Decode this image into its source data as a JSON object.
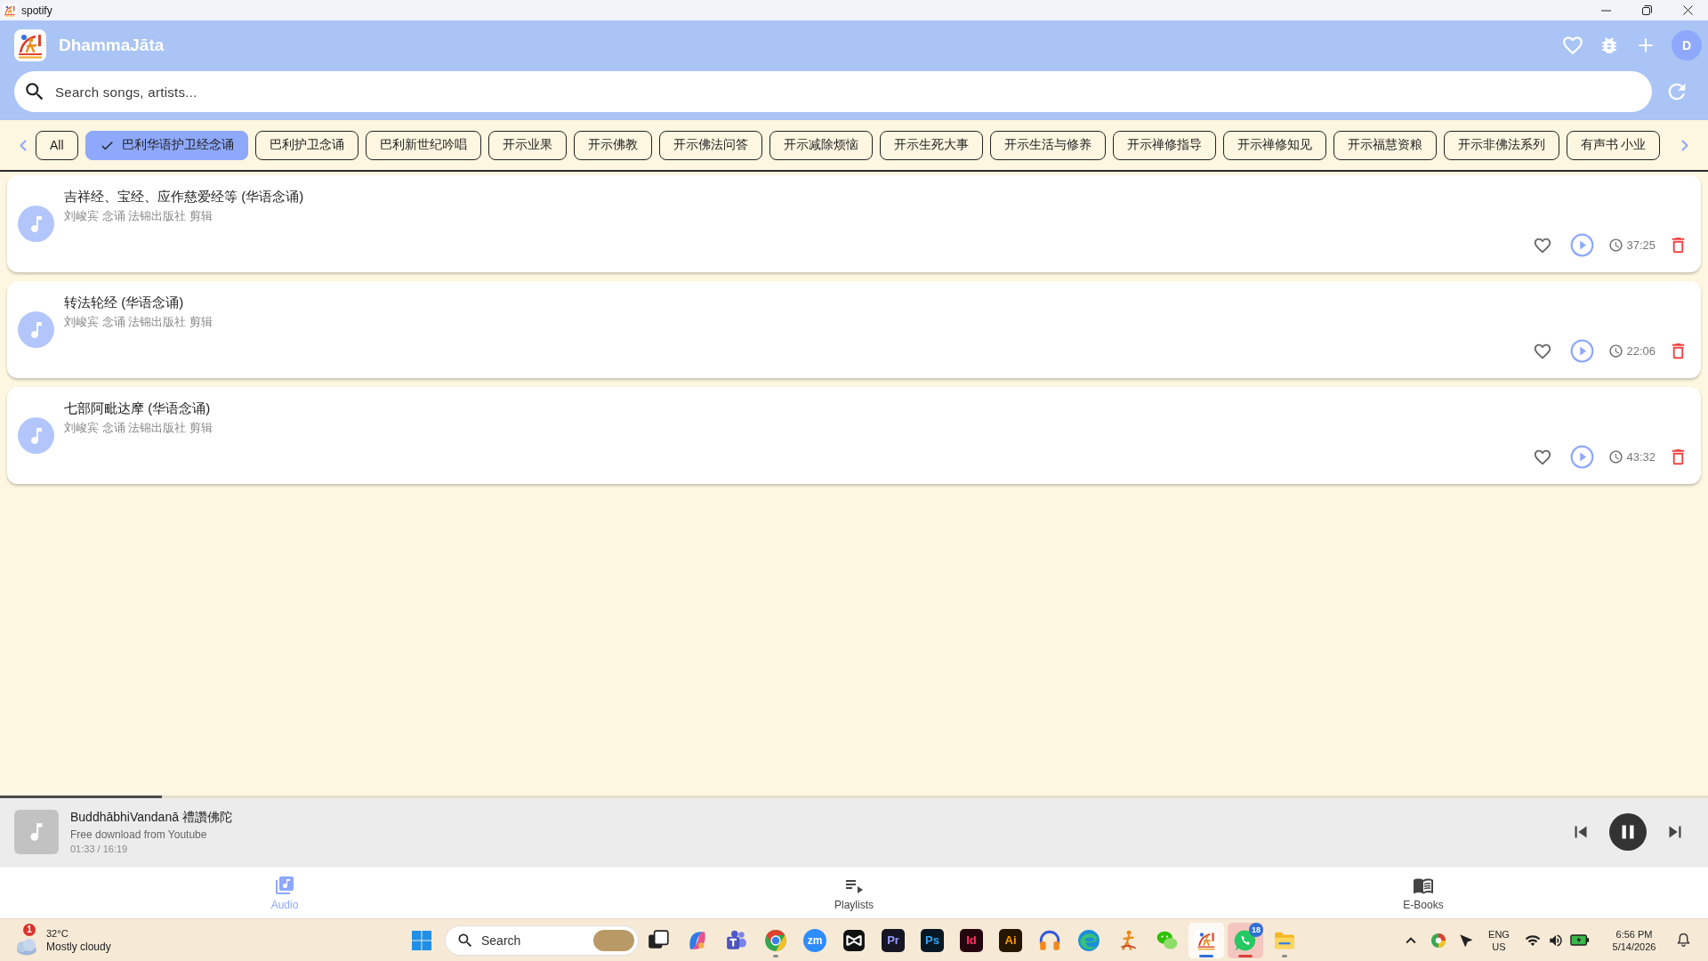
{
  "window": {
    "title": "spotify"
  },
  "header": {
    "title": "DhammaJāta",
    "avatar": "D"
  },
  "search": {
    "placeholder": "Search songs, artists..."
  },
  "categories": [
    {
      "label": "All",
      "selected": false
    },
    {
      "label": "巴利华语护卫经念诵",
      "selected": true
    },
    {
      "label": "巴利护卫念诵",
      "selected": false
    },
    {
      "label": "巴利新世纪吟唱",
      "selected": false
    },
    {
      "label": "开示业果",
      "selected": false
    },
    {
      "label": "开示佛教",
      "selected": false
    },
    {
      "label": "开示佛法问答",
      "selected": false
    },
    {
      "label": "开示减除烦恼",
      "selected": false
    },
    {
      "label": "开示生死大事",
      "selected": false
    },
    {
      "label": "开示生活与修养",
      "selected": false
    },
    {
      "label": "开示禅修指导",
      "selected": false
    },
    {
      "label": "开示禅修知见",
      "selected": false
    },
    {
      "label": "开示福慧资粮",
      "selected": false
    },
    {
      "label": "开示非佛法系列",
      "selected": false
    },
    {
      "label": "有声书 小业",
      "selected": false
    }
  ],
  "tracks": [
    {
      "title": "吉祥经、宝经、应作慈爱经等 (华语念诵)",
      "subtitle": "刘峻宾 念诵 法锦出版社 剪辑",
      "duration": "37:25",
      "liked": false
    },
    {
      "title": "转法轮经 (华语念诵)",
      "subtitle": "刘峻宾 念诵 法锦出版社 剪辑",
      "duration": "22:06",
      "liked": false
    },
    {
      "title": "七部阿毗达摩 (华语念诵)",
      "subtitle": "刘峻宾 念诵 法锦出版社 剪辑",
      "duration": "43:32",
      "liked": false
    }
  ],
  "player": {
    "title": "BuddhābhiVandanā 禮讚佛陀",
    "subtitle": "Free download from Youtube",
    "time": "01:33 / 16:19",
    "level": 0.095,
    "playing": true
  },
  "nav": [
    {
      "kind": "audio",
      "label": "Audio",
      "selected": true
    },
    {
      "kind": "playlists",
      "label": "Playlists",
      "selected": false
    },
    {
      "kind": "ebooks",
      "label": "E-Books",
      "selected": false
    }
  ],
  "taskbar": {
    "weather": {
      "alerts": "1",
      "temperature": "32°C",
      "condition": "Mostly cloudy"
    },
    "search": {
      "placeholder": "Search"
    },
    "apps": [
      {
        "kind": "taskview",
        "running": false,
        "active": false,
        "flashing": false
      },
      {
        "kind": "copilot",
        "running": false,
        "active": false,
        "flashing": false
      },
      {
        "kind": "teams",
        "running": false,
        "active": false,
        "flashing": false
      },
      {
        "kind": "chrome",
        "running": true,
        "active": false,
        "flashing": false
      },
      {
        "kind": "circle",
        "label": "zm",
        "color": "#2d8cff",
        "running": false,
        "active": false,
        "flashing": false
      },
      {
        "kind": "capcut",
        "running": false,
        "active": false,
        "flashing": false
      },
      {
        "kind": "letters",
        "label": "Pr",
        "color": "#9999ff",
        "running": false,
        "active": false,
        "flashing": false
      },
      {
        "kind": "letters",
        "label": "Ps",
        "color": "#31a8ff",
        "running": false,
        "active": false,
        "flashing": false
      },
      {
        "kind": "letters",
        "label": "Id",
        "color": "#ff3366",
        "running": false,
        "active": false,
        "flashing": false
      },
      {
        "kind": "letters",
        "label": "Ai",
        "color": "#ff9a00",
        "running": false,
        "active": false,
        "flashing": false
      },
      {
        "kind": "headphones",
        "running": false,
        "active": false,
        "flashing": false
      },
      {
        "kind": "edge",
        "running": false,
        "active": false,
        "flashing": false
      },
      {
        "kind": "figure",
        "running": false,
        "active": false,
        "flashing": false
      },
      {
        "kind": "wechat",
        "running": false,
        "active": false,
        "flashing": false
      },
      {
        "kind": "applogo",
        "running": true,
        "active": true,
        "flashing": false
      },
      {
        "kind": "whatsapp",
        "running": true,
        "active": false,
        "flashing": true,
        "badge": "18"
      },
      {
        "kind": "folder",
        "running": true,
        "active": false,
        "flashing": false
      }
    ],
    "tray": {
      "language": "ENG",
      "region": "US",
      "time": "6:56 PM",
      "date": "5/14/2026"
    }
  }
}
